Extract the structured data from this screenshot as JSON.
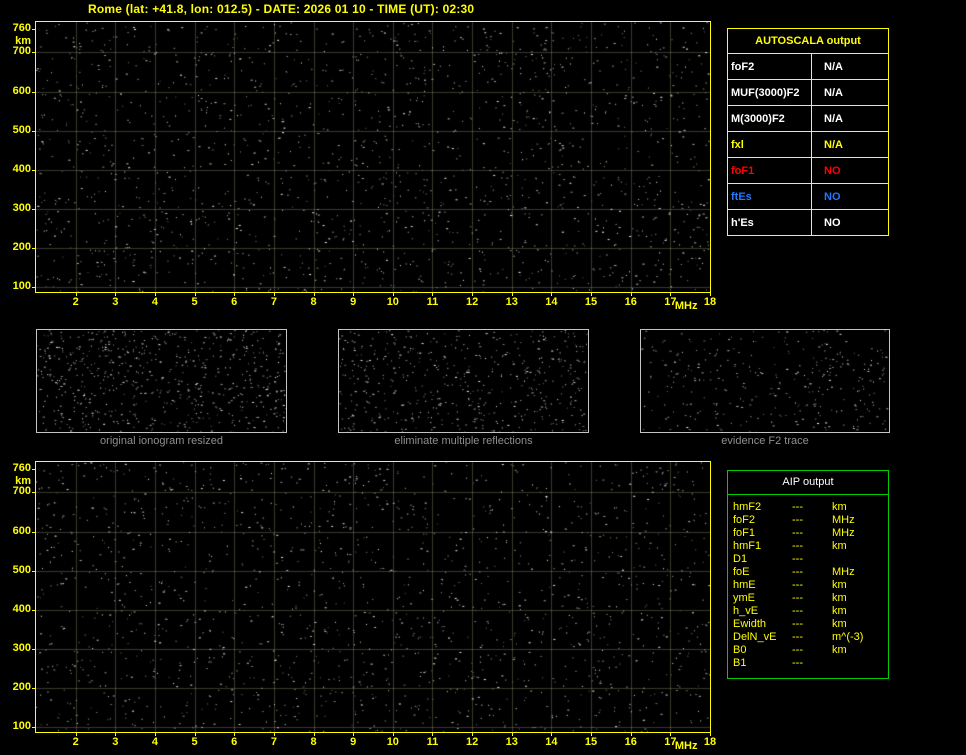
{
  "title": "Rome (lat: +41.8, lon: 012.5) - DATE: 2026 01 10 - TIME (UT): 02:30",
  "colors": {
    "background": "#000000",
    "accent_yellow": "#ffff00",
    "aip_border_green": "#00cc00",
    "caption_gray": "#8f8f8f",
    "value_white": "#ffffff",
    "value_red": "#ff0000",
    "value_blue": "#2277ff"
  },
  "ionogram": {
    "y_ticks": [
      "760",
      "700",
      "600",
      "500",
      "400",
      "300",
      "200",
      "100"
    ],
    "y_unit": "km",
    "x_ticks": [
      "2",
      "3",
      "4",
      "5",
      "6",
      "7",
      "8",
      "9",
      "10",
      "11",
      "12",
      "13",
      "14",
      "15",
      "16",
      "17",
      "18"
    ],
    "x_unit": "MHz",
    "freq_range_mhz": [
      1,
      18
    ],
    "height_range_km": [
      100,
      760
    ]
  },
  "autoscala_table": {
    "header": "AUTOSCALA output",
    "rows": [
      {
        "param": "foF2",
        "value": "N/A",
        "color": "#ffffff"
      },
      {
        "param": "MUF(3000)F2",
        "value": "N/A",
        "color": "#ffffff"
      },
      {
        "param": "M(3000)F2",
        "value": "N/A",
        "color": "#ffffff"
      },
      {
        "param": "fxl",
        "value": "N/A",
        "color": "#ffff00"
      },
      {
        "param": "foF1",
        "value": "NO",
        "color": "#ff0000"
      },
      {
        "param": "ftEs",
        "value": "NO",
        "color": "#2277ff"
      },
      {
        "param": "h'Es",
        "value": "NO",
        "color": "#ffffff"
      }
    ]
  },
  "thumbnails": [
    {
      "caption": "original ionogram resized"
    },
    {
      "caption": "eliminate multiple reflections"
    },
    {
      "caption": "evidence F2 trace"
    }
  ],
  "aip_table": {
    "header": "AIP output",
    "rows": [
      {
        "param": "hmF2",
        "value": "---",
        "unit": "km"
      },
      {
        "param": "foF2",
        "value": "---",
        "unit": "MHz"
      },
      {
        "param": "foF1",
        "value": "---",
        "unit": "MHz"
      },
      {
        "param": "hmF1",
        "value": "---",
        "unit": "km"
      },
      {
        "param": "D1",
        "value": "---",
        "unit": ""
      },
      {
        "param": "foE",
        "value": "---",
        "unit": "MHz"
      },
      {
        "param": "hmE",
        "value": "---",
        "unit": "km"
      },
      {
        "param": "ymE",
        "value": "---",
        "unit": "km"
      },
      {
        "param": "h_vE",
        "value": "---",
        "unit": "km"
      },
      {
        "param": "Ewidth",
        "value": "---",
        "unit": "km"
      },
      {
        "param": "DelN_vE",
        "value": "---",
        "unit": "m^(-3)"
      },
      {
        "param": "B0",
        "value": "---",
        "unit": "km"
      },
      {
        "param": "B1",
        "value": "---",
        "unit": ""
      }
    ]
  }
}
